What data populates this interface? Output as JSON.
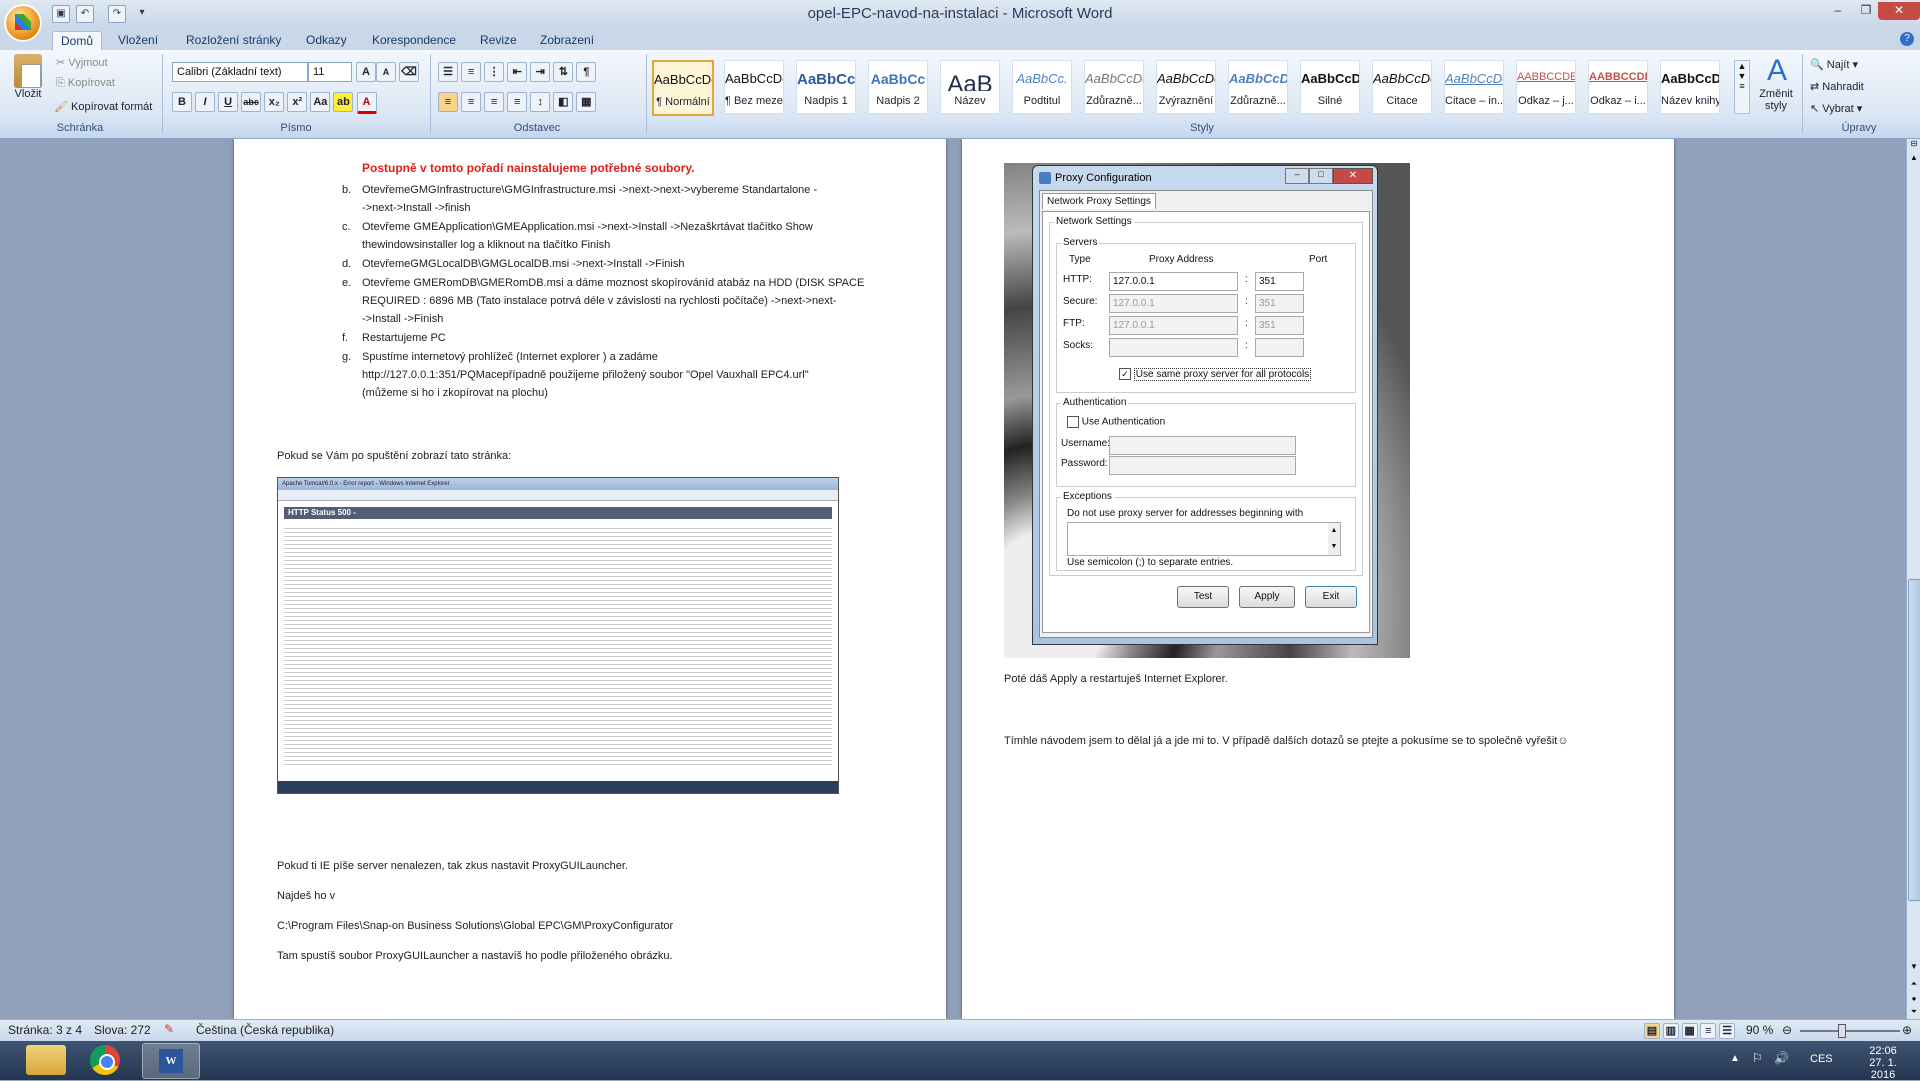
{
  "app": {
    "title": "opel-EPC-navod-na-instalaci - Microsoft Word",
    "tabs": [
      "Domů",
      "Vložení",
      "Rozložení stránky",
      "Odkazy",
      "Korespondence",
      "Revize",
      "Zobrazení"
    ]
  },
  "ribbon": {
    "clipboard": {
      "paste": "Vložit",
      "cut": "Vyjmout",
      "copy": "Kopírovat",
      "format_painter": "Kopírovat formát",
      "label": "Schránka"
    },
    "font": {
      "name": "Calibri (Základní text)",
      "size": "11",
      "label": "Písmo"
    },
    "paragraph": {
      "label": "Odstavec"
    },
    "styles": {
      "label": "Styly",
      "items": [
        {
          "preview": "AaBbCcDc",
          "name": "¶ Normální"
        },
        {
          "preview": "AaBbCcDc",
          "name": "¶ Bez mezer"
        },
        {
          "preview": "AaBbCc",
          "name": "Nadpis 1"
        },
        {
          "preview": "AaBbCc",
          "name": "Nadpis 2"
        },
        {
          "preview": "AaB",
          "name": "Název"
        },
        {
          "preview": "AaBbCc.",
          "name": "Podtitul"
        },
        {
          "preview": "AaBbCcDc",
          "name": "Zdůrazně..."
        },
        {
          "preview": "AaBbCcDc",
          "name": "Zvýraznění"
        },
        {
          "preview": "AaBbCcDc",
          "name": "Zdůrazně..."
        },
        {
          "preview": "AaBbCcDc",
          "name": "Silné"
        },
        {
          "preview": "AaBbCcDc",
          "name": "Citace"
        },
        {
          "preview": "AaBbCcDc",
          "name": "Citace – in..."
        },
        {
          "preview": "AABBCCDE",
          "name": "Odkaz – j..."
        },
        {
          "preview": "AABBCCDE",
          "name": "Odkaz – i..."
        },
        {
          "preview": "AaBbCcDc",
          "name": "Název knihy"
        }
      ],
      "change": "Změnit styly"
    },
    "editing": {
      "find": "Najít",
      "replace": "Nahradit",
      "select": "Vybrat",
      "label": "Úpravy"
    }
  },
  "page_left": {
    "heading": "Postupně v tomto pořadí nainstalujeme potřebné soubory.",
    "list": [
      {
        "marker": "b.",
        "lines": [
          "OtevřemeGMGInfrastructure\\GMGInfrastructure.msi ->next->next->vybereme Standartalone -",
          "->next->Install ->finish"
        ]
      },
      {
        "marker": "c.",
        "lines": [
          "Otevřeme GMEApplication\\GMEApplication.msi ->next->Install ->Nezaškrtávat tlačítko Show",
          "thewindowsinstaller log a kliknout na tlačítko Finish"
        ]
      },
      {
        "marker": "d.",
        "lines": [
          "OtevřemeGMGLocalDB\\GMGLocalDB.msi ->next->Install ->Finish"
        ]
      },
      {
        "marker": "e.",
        "lines": [
          "Otevřeme GMERomDB\\GMERomDB.msi  a dáme moznost skopírováníd atabáz na HDD (DISK SPACE",
          "REQUIRED : 6896 MB (Tato instalace potrvá déle v závislosti na rychlosti počítače) ->next->next-",
          "->Install ->Finish"
        ]
      },
      {
        "marker": "f.",
        "lines": [
          "Restartujeme PC"
        ]
      },
      {
        "marker": "g.",
        "lines": [
          "Spustíme internetový prohlížeč (Internet explorer ) a zadáme",
          "http://127.0.0.1:351/PQMacepřípadně použijeme přiložený soubor \"Opel Vauxhall EPC4.url\"",
          "(můžeme si ho i zkopírovat na plochu)"
        ]
      }
    ],
    "p_error_intro": "Pokud se Vám po spuštění zobrazí tato stránka:",
    "screenshot": {
      "title_bar": "Apache Tomcat/6.0.x - Error report - Windows Internet Explorer",
      "heading": "HTTP Status 500 -"
    },
    "p_server": "Pokud ti IE píše server nenalezen, tak zkus nastavit  ProxyGUILauncher.",
    "p_find": "Najdeš ho v",
    "p_path": " C:\\Program Files\\Snap-on Business Solutions\\Global EPC\\GM\\ProxyConfigurator",
    "p_run": "Tam spustíš soubor ProxyGUILauncher a nastavíš ho podle přiloženého obrázku."
  },
  "proxy_dialog": {
    "title": "Proxy Configuration",
    "tab": "Network Proxy Settings",
    "group_network": "Network Settings",
    "group_servers": "Servers",
    "col_type": "Type",
    "col_address": "Proxy Address",
    "col_port": "Port",
    "rows": [
      {
        "type": "HTTP:",
        "address": "127.0.0.1",
        "port": "351",
        "enabled": true
      },
      {
        "type": "Secure:",
        "address": "127.0.0.1",
        "port": "351",
        "enabled": false
      },
      {
        "type": "FTP:",
        "address": "127.0.0.1",
        "port": "351",
        "enabled": false
      },
      {
        "type": "Socks:",
        "address": "",
        "port": "",
        "enabled": false
      }
    ],
    "same_proxy": "Use same proxy server for all protocols",
    "group_auth": "Authentication",
    "use_auth": "Use Authentication",
    "username": "Username:",
    "password": "Password:",
    "group_exceptions": "Exceptions",
    "exceptions_label": "Do not use proxy server for addresses beginning with",
    "exceptions_hint": "Use semicolon (;) to separate entries.",
    "btn_test": "Test",
    "btn_apply": "Apply",
    "btn_exit": "Exit"
  },
  "page_right": {
    "p_apply": "Poté dáš Apply a  restartuješ Internet Explorer.",
    "p_final": "Tímhle návodem jsem to dělal já a jde mi to. V případě dalších dotazů se ptejte a pokusíme se to společně vyřešit☺"
  },
  "status": {
    "page": "Stránka: 3 z 4",
    "words": "Slova: 272",
    "language": "Čeština (Česká republika)",
    "zoom": "90 %"
  },
  "taskbar": {
    "lang": "CES",
    "time": "22:06",
    "date": "27. 1. 2016"
  }
}
